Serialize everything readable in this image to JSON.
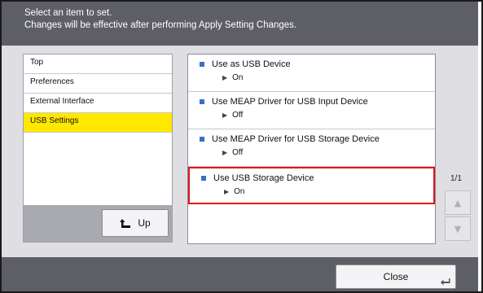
{
  "header": {
    "line1": "Select an item to set.",
    "line2": "Changes will be effective after performing Apply Setting Changes."
  },
  "tree": {
    "items": [
      {
        "label": "Top"
      },
      {
        "label": "Preferences"
      },
      {
        "label": "External Interface"
      },
      {
        "label": "USB Settings",
        "selected": true
      }
    ],
    "up_label": "Up"
  },
  "settings": {
    "items": [
      {
        "title": "Use as USB Device",
        "value": "On"
      },
      {
        "title": "Use MEAP Driver for USB Input Device",
        "value": "Off"
      },
      {
        "title": "Use MEAP Driver for USB Storage Device",
        "value": "Off"
      },
      {
        "title": "Use USB Storage Device",
        "value": "On",
        "highlighted": true
      }
    ]
  },
  "pagination": {
    "label": "1/1"
  },
  "footer": {
    "close_label": "Close"
  },
  "colors": {
    "selected": "#ffe800",
    "highlight_border": "#e3141b",
    "bullet": "#3a6ec8",
    "header_bg": "#5e5e66"
  },
  "icons": {
    "up": "up-arrow-icon",
    "scroll_up": "triangle-up-icon",
    "scroll_down": "triangle-down-icon",
    "close": "enter-return-icon"
  }
}
